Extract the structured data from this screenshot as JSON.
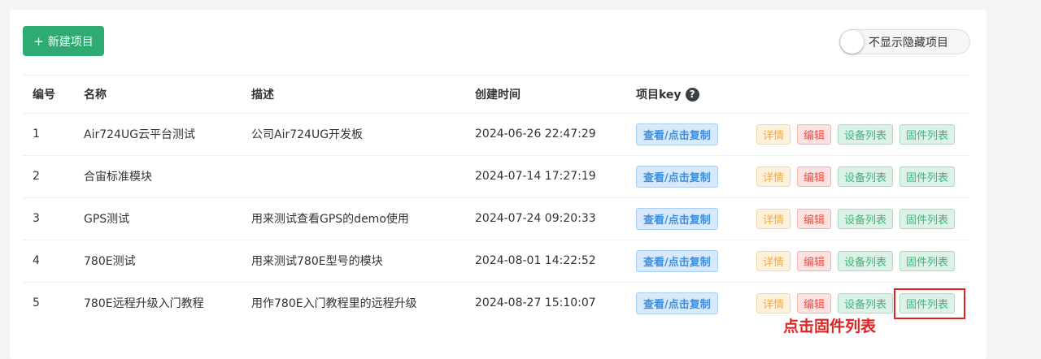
{
  "toolbar": {
    "new_project_label": "新建项目",
    "plus": "+"
  },
  "toggle": {
    "label": "不显示隐藏项目"
  },
  "table": {
    "headers": {
      "no": "编号",
      "name": "名称",
      "desc": "描述",
      "created": "创建时间",
      "key": "项目key",
      "help": "?"
    },
    "key_button": "查看/点击复制",
    "actions": {
      "detail": "详情",
      "edit": "编辑",
      "devices": "设备列表",
      "firmware": "固件列表"
    },
    "rows": [
      {
        "no": "1",
        "name": "Air724UG云平台测试",
        "desc": "公司Air724UG开发板",
        "created": "2024-06-26 22:47:29"
      },
      {
        "no": "2",
        "name": "合宙标准模块",
        "desc": "",
        "created": "2024-07-14 17:27:19"
      },
      {
        "no": "3",
        "name": "GPS测试",
        "desc": "用来测试查看GPS的demo使用",
        "created": "2024-07-24 09:20:33"
      },
      {
        "no": "4",
        "name": "780E测试",
        "desc": "用来测试780E型号的模块",
        "created": "2024-08-01 14:22:52"
      },
      {
        "no": "5",
        "name": "780E远程升级入门教程",
        "desc": "用作780E入门教程里的远程升级",
        "created": "2024-08-27 15:10:07"
      }
    ]
  },
  "annotation": {
    "text": "点击固件列表",
    "color": "#e02222"
  },
  "colors": {
    "primary": "#2eab73",
    "info": "#3b8fe0",
    "warning": "#f0ac4b",
    "danger": "#e6554c",
    "success": "#3cb47c"
  }
}
